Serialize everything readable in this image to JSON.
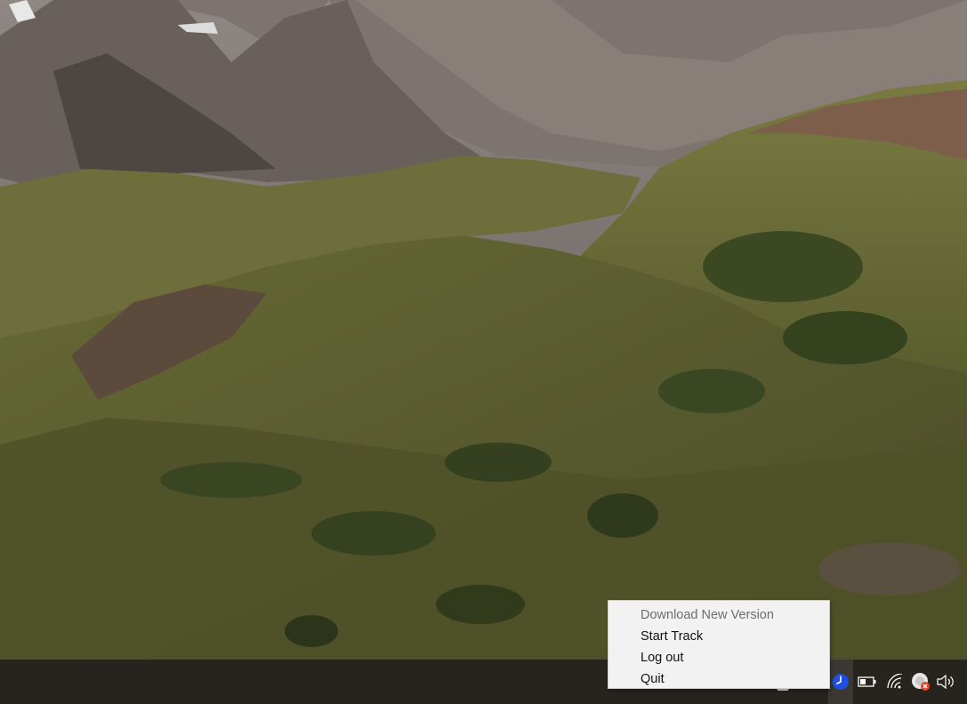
{
  "context_menu": {
    "items": [
      {
        "label": "Download New Version",
        "enabled": false
      },
      {
        "label": "Start Track",
        "enabled": true
      },
      {
        "label": "Log out",
        "enabled": true
      },
      {
        "label": "Quit",
        "enabled": true
      }
    ]
  },
  "taskbar": {
    "tray_icons": [
      {
        "name": "clock-app-icon",
        "color": "#1f4fe0"
      },
      {
        "name": "battery-icon"
      },
      {
        "name": "wifi-icon"
      },
      {
        "name": "sync-error-icon",
        "badge_color": "#e8412c"
      },
      {
        "name": "volume-icon"
      }
    ]
  },
  "colors": {
    "taskbar_bg": "#27241f",
    "menu_bg": "#f2f2f2",
    "menu_disabled_text": "#6d6d6d"
  }
}
